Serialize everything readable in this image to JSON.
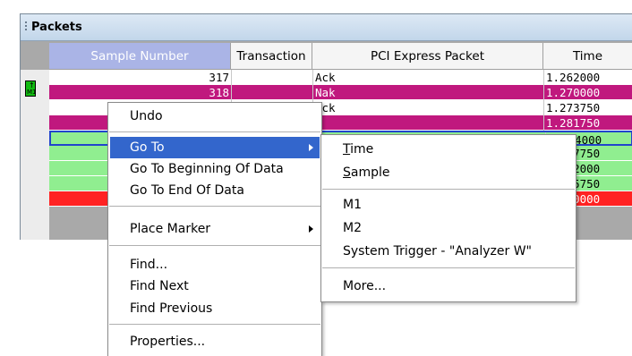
{
  "window": {
    "title": "Packets"
  },
  "columns": {
    "sample": "Sample Number",
    "transaction": "Transaction",
    "pci": "PCI Express Packet",
    "time": "Time"
  },
  "marker": {
    "top": "↑",
    "bottom": "M1"
  },
  "rows": [
    {
      "sample": "317",
      "pci": "Ack",
      "time": "1.262000",
      "bg": "#ffffff",
      "color": "#000000"
    },
    {
      "sample": "318",
      "pci": "Nak",
      "time": "1.270000",
      "bg": "#c0187e",
      "color": "#ffffff"
    },
    {
      "sample": "",
      "pci": "Ack",
      "time": "1.273750",
      "bg": "#ffffff",
      "color": "#000000"
    },
    {
      "sample": "",
      "pci": "",
      "time": "1.281750",
      "bg": "#c0187e",
      "color": "#ffffff"
    },
    {
      "sample": "",
      "pci": "",
      "time": "1.284000",
      "bg": "#90ee90",
      "color": "#000000"
    },
    {
      "sample": "",
      "pci": "",
      "time": "1.287750",
      "bg": "#90ee90",
      "color": "#000000"
    },
    {
      "sample": "",
      "pci": "",
      "time": "1.292000",
      "bg": "#90ee90",
      "color": "#000000"
    },
    {
      "sample": "",
      "pci": "",
      "time": "1.295750",
      "bg": "#90ee90",
      "color": "#000000"
    },
    {
      "sample": "",
      "pci": "",
      "time": "1.300000",
      "bg": "#ff2222",
      "color": "#ffffff"
    }
  ],
  "context_menu": {
    "undo": "Undo",
    "goto": "Go To",
    "goto_beginning": "Go To Beginning Of Data",
    "goto_end": "Go To End Of Data",
    "place_marker": "Place Marker",
    "find": "Find...",
    "find_next": "Find Next",
    "find_previous": "Find Previous",
    "properties": "Properties..."
  },
  "submenu": {
    "time_ul": "T",
    "time_rest": "ime",
    "sample_ul": "S",
    "sample_rest": "ample",
    "m1": "M1",
    "m2": "M2",
    "system_trigger": "System Trigger - \"Analyzer W\"",
    "more": "More..."
  },
  "colors": {
    "highlight": "#3366cc",
    "nak_row": "#c0187e",
    "selected_row": "#90ee90",
    "trigger_row": "#ff2222"
  }
}
